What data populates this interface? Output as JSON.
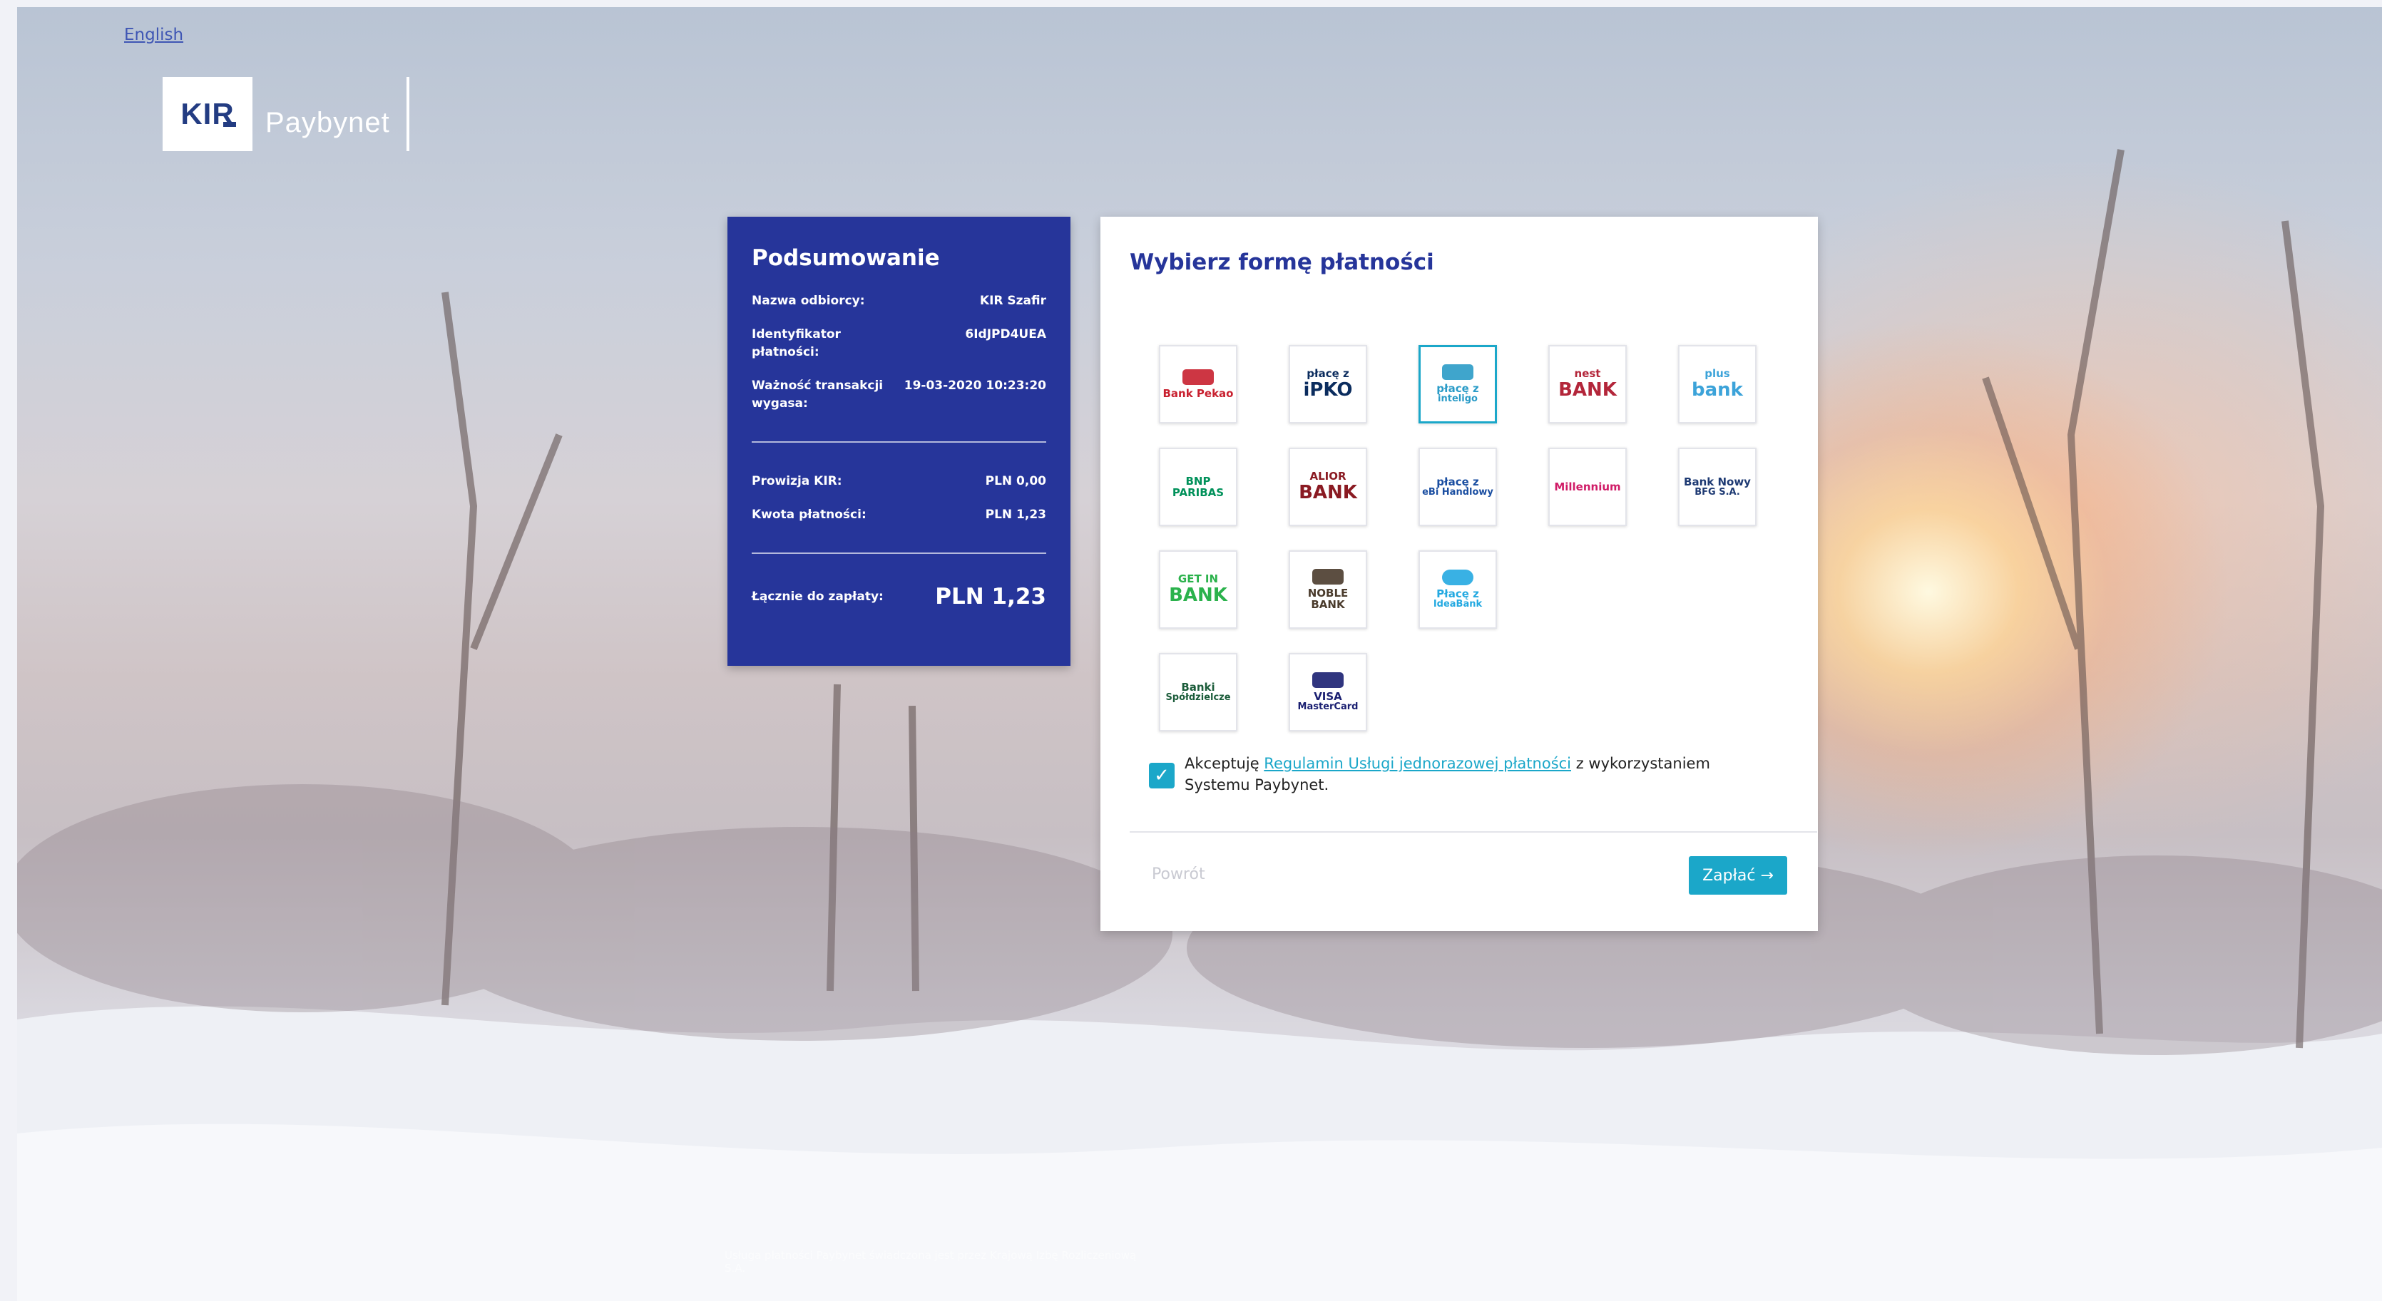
{
  "language_link": "English",
  "logo": {
    "kir": "KIR",
    "product": "Paybynet"
  },
  "summary": {
    "title": "Podsumowanie",
    "rows": [
      {
        "label": "Nazwa odbiorcy:",
        "value": "KIR Szafir"
      },
      {
        "label": "Identyfikator płatności:",
        "value": "6IdJPD4UEA"
      },
      {
        "label": "Ważność transakcji wygasa:",
        "value": "19-03-2020 10:23:20"
      }
    ],
    "fees": [
      {
        "label": "Prowizja KIR:",
        "value": "PLN 0,00"
      },
      {
        "label": "Kwota płatności:",
        "value": "PLN 1,23"
      }
    ],
    "total": {
      "label": "Łącznie do zapłaty:",
      "value": "PLN 1,23"
    }
  },
  "payment": {
    "title": "Wybierz formę płatności",
    "banks": [
      {
        "line1": "Bank Pekao",
        "line2": "",
        "color": "#c8202f",
        "icon": "bison-icon"
      },
      {
        "line1": "płacę z",
        "line2": "iPKO",
        "color": "#0b2c5e",
        "icon": ""
      },
      {
        "line1": "płacę z",
        "line2": "inteligo",
        "color": "#2a9bc7",
        "icon": "camera-icon",
        "selected": true
      },
      {
        "line1": "nest",
        "line2": "BANK",
        "color": "#b3263a",
        "icon": ""
      },
      {
        "line1": "plus",
        "line2": "bank",
        "color": "#3ca3d9",
        "icon": ""
      },
      {
        "line1": "BNP PARIBAS",
        "line2": "",
        "color": "#00915a",
        "icon": ""
      },
      {
        "line1": "ALIOR",
        "line2": "BANK",
        "color": "#8a1a22",
        "icon": ""
      },
      {
        "line1": "płacę z",
        "line2": "eBi Handlowy",
        "color": "#1a4ea1",
        "icon": ""
      },
      {
        "line1": "Millennium",
        "line2": "",
        "color": "#d01c67",
        "icon": ""
      },
      {
        "line1": "Bank Nowy",
        "line2": "BFG S.A.",
        "color": "#1e3a73",
        "icon": ""
      },
      {
        "line1": "GET IN",
        "line2": "BANK",
        "color": "#2bb24c",
        "icon": ""
      },
      {
        "line1": "NOBLE BANK",
        "line2": "",
        "color": "#4a3b2c",
        "icon": "tree-icon"
      },
      {
        "line1": "Płacę z",
        "line2": "IdeaBank",
        "color": "#23a9e1",
        "icon": "cloud-icon"
      },
      {
        "line1": "Banki",
        "line2": "Spółdzielcze",
        "color": "#1b5c3a",
        "icon": ""
      },
      {
        "line1": "VISA",
        "line2": "MasterCard",
        "color": "#1a1f71",
        "icon": "cards-icon"
      }
    ],
    "accept_before": "Akceptuję ",
    "accept_link": "Regulamin Usługi jednorazowej płatności",
    "accept_after": " z wykorzystaniem Systemu Paybynet.",
    "back_label": "Powrót",
    "pay_label": "Zapłać →"
  },
  "footer": "Usługa płatności Paybynet świadczona jest przez Krajową Izbę Rozliczeniową S.A."
}
